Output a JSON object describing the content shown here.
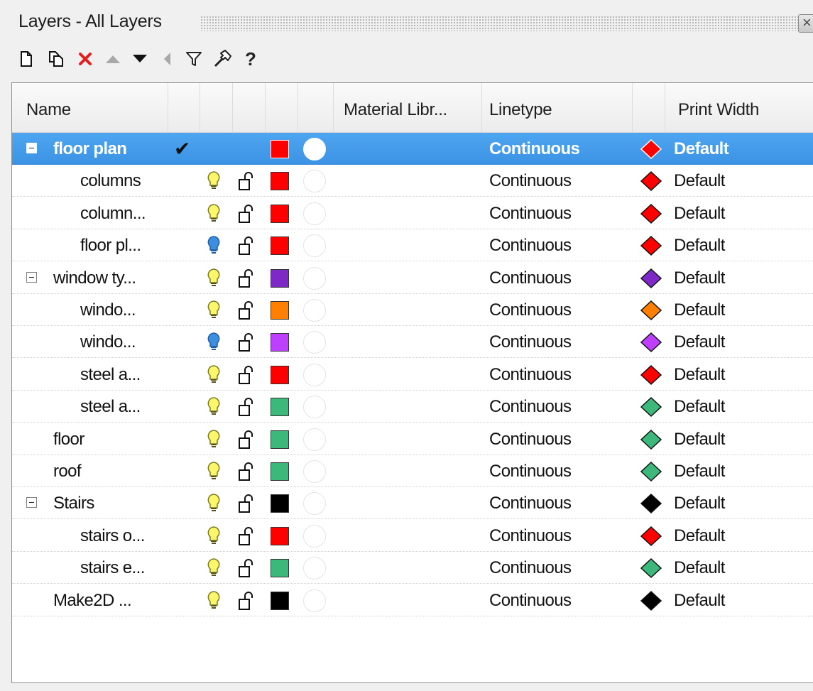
{
  "panel": {
    "title": "Layers - All Layers"
  },
  "toolbar": {
    "buttons": [
      {
        "name": "new-layer-icon",
        "color": "#111111"
      },
      {
        "name": "new-sublayer-icon",
        "color": "#111111"
      },
      {
        "name": "delete-icon",
        "color": "#e02020"
      },
      {
        "name": "move-up-icon",
        "color": "#a8a8a8"
      },
      {
        "name": "move-down-icon",
        "color": "#111111"
      },
      {
        "name": "move-out-icon",
        "color": "#a8a8a8"
      },
      {
        "name": "filter-icon",
        "color": "#222222"
      },
      {
        "name": "tools-icon",
        "color": "#222222"
      }
    ],
    "help_label": "?"
  },
  "columns": {
    "name": "Name",
    "material": "Material Libr...",
    "linetype": "Linetype",
    "print_width": "Print Width"
  },
  "layers": [
    {
      "name": "floor plan",
      "level": 0,
      "expander": true,
      "current": true,
      "selected": true,
      "bulb": "",
      "color": "#ff0000",
      "linetype": "Continuous",
      "print_width": "Default"
    },
    {
      "name": "columns",
      "level": 1,
      "expander": false,
      "current": false,
      "selected": false,
      "bulb": "on",
      "color": "#ff0000",
      "linetype": "Continuous",
      "print_width": "Default"
    },
    {
      "name": "column...",
      "level": 1,
      "expander": false,
      "current": false,
      "selected": false,
      "bulb": "on",
      "color": "#ff0000",
      "linetype": "Continuous",
      "print_width": "Default"
    },
    {
      "name": "floor pl...",
      "level": 1,
      "expander": false,
      "current": false,
      "selected": false,
      "bulb": "blue",
      "color": "#ff0000",
      "linetype": "Continuous",
      "print_width": "Default"
    },
    {
      "name": "window ty...",
      "level": 0,
      "expander": true,
      "current": false,
      "selected": false,
      "bulb": "on",
      "color": "#7f28c8",
      "linetype": "Continuous",
      "print_width": "Default"
    },
    {
      "name": "windo...",
      "level": 1,
      "expander": false,
      "current": false,
      "selected": false,
      "bulb": "on",
      "color": "#ff7f00",
      "linetype": "Continuous",
      "print_width": "Default"
    },
    {
      "name": "windo...",
      "level": 1,
      "expander": false,
      "current": false,
      "selected": false,
      "bulb": "blue",
      "color": "#bf3fff",
      "linetype": "Continuous",
      "print_width": "Default"
    },
    {
      "name": "steel a...",
      "level": 1,
      "expander": false,
      "current": false,
      "selected": false,
      "bulb": "on",
      "color": "#ff0000",
      "linetype": "Continuous",
      "print_width": "Default"
    },
    {
      "name": "steel a...",
      "level": 1,
      "expander": false,
      "current": false,
      "selected": false,
      "bulb": "on",
      "color": "#3cb97a",
      "linetype": "Continuous",
      "print_width": "Default"
    },
    {
      "name": "floor",
      "level": 0,
      "expander": false,
      "current": false,
      "selected": false,
      "bulb": "on",
      "color": "#3cb97a",
      "linetype": "Continuous",
      "print_width": "Default"
    },
    {
      "name": "roof",
      "level": 0,
      "expander": false,
      "current": false,
      "selected": false,
      "bulb": "on",
      "color": "#3cb97a",
      "linetype": "Continuous",
      "print_width": "Default"
    },
    {
      "name": "Stairs",
      "level": 0,
      "expander": true,
      "current": false,
      "selected": false,
      "bulb": "on",
      "color": "#000000",
      "linetype": "Continuous",
      "print_width": "Default"
    },
    {
      "name": "stairs o...",
      "level": 1,
      "expander": false,
      "current": false,
      "selected": false,
      "bulb": "on",
      "color": "#ff0000",
      "linetype": "Continuous",
      "print_width": "Default"
    },
    {
      "name": "stairs e...",
      "level": 1,
      "expander": false,
      "current": false,
      "selected": false,
      "bulb": "on",
      "color": "#3cb97a",
      "linetype": "Continuous",
      "print_width": "Default"
    },
    {
      "name": "Make2D ...",
      "level": 0,
      "expander": false,
      "current": false,
      "selected": false,
      "bulb": "on",
      "color": "#000000",
      "linetype": "Continuous",
      "print_width": "Default"
    }
  ]
}
